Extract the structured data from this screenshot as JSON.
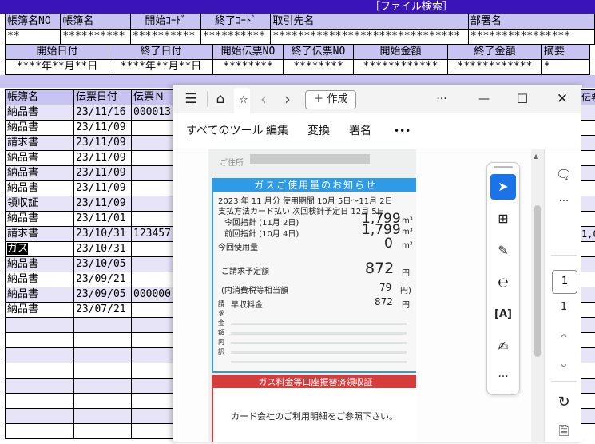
{
  "app": {
    "title": "［ファイル検索］"
  },
  "header1": {
    "labels": [
      "帳簿名NO",
      "帳簿名",
      "開始ｺｰﾄﾞ",
      "終了ｺｰﾄﾞ",
      "取引先名",
      "部署名"
    ],
    "values": [
      "**",
      "**********",
      "**********",
      "**********",
      "******************************",
      "****************"
    ]
  },
  "header2": {
    "labels": [
      "開始日付",
      "終了日付",
      "開始伝票NO",
      "終了伝票NO",
      "開始金額",
      "終了金額",
      "摘要"
    ],
    "values": [
      "****年**月**日",
      "****年**月**日",
      "********",
      "********",
      "************",
      "************",
      "*"
    ]
  },
  "list": {
    "columns": [
      "帳簿名",
      "伝票日付",
      "伝票Ｎ"
    ],
    "rows": [
      {
        "name": "納品書",
        "date": "23/11/16",
        "no": "000013"
      },
      {
        "name": "納品書",
        "date": "23/11/09",
        "no": ""
      },
      {
        "name": "請求書",
        "date": "23/11/09",
        "no": ""
      },
      {
        "name": "納品書",
        "date": "23/11/09",
        "no": ""
      },
      {
        "name": "納品書",
        "date": "23/11/09",
        "no": ""
      },
      {
        "name": "納品書",
        "date": "23/11/09",
        "no": ""
      },
      {
        "name": "領収証",
        "date": "23/11/09",
        "no": ""
      },
      {
        "name": "納品書",
        "date": "23/11/01",
        "no": ""
      },
      {
        "name": "請求書",
        "date": "23/10/31",
        "no": "123457"
      },
      {
        "name": "ガス",
        "date": "23/10/31",
        "no": ""
      },
      {
        "name": "納品書",
        "date": "23/10/05",
        "no": ""
      },
      {
        "name": "納品書",
        "date": "23/09/21",
        "no": ""
      },
      {
        "name": "納品書",
        "date": "23/09/05",
        "no": "000000"
      },
      {
        "name": "納品書",
        "date": "23/07/21",
        "no": ""
      }
    ],
    "right_edge": [
      "伝票",
      "",
      "",
      "",
      "",
      "",
      "",
      "",
      "",
      "1,0",
      "",
      "",
      "",
      ""
    ]
  },
  "viewer": {
    "toolbar": {
      "menu": "☰",
      "home": "⌂",
      "back": "‹",
      "forward": "›",
      "create": "＋ 作成",
      "more": "···",
      "minimize": "—",
      "maximize": "☐",
      "close": "✕"
    },
    "tabs": [
      "すべてのツール",
      "編集",
      "変換",
      "署名",
      "•••"
    ],
    "page_number": "1",
    "page_total": "1",
    "side_icons": [
      "comment-icon",
      "more-icon",
      "zoom-up-icon",
      "zoom-down-icon",
      "rotate-icon",
      "page-fit-icon"
    ]
  },
  "receipt": {
    "address_label": "ご住所",
    "title": "ガスご使用量のお知らせ",
    "line1": "2023 年 11 月分  使用期間  10月 5日〜11月 2日",
    "line2": "支払方法カード払い   次回検針予定日  12月 5日",
    "reading_now_label": "今回指針 (11月 2日)",
    "reading_now": "1,799",
    "reading_prev_label": "前回指針 (10月 4日)",
    "reading_prev": "1,799",
    "unit": "m³",
    "usage_label": "今回使用量",
    "usage": "0",
    "billing_label": "ご請求予定額",
    "billing": "872",
    "yen": "円",
    "tax_label": "(内消費税等相当額",
    "tax": "79",
    "tax_yen": "円)",
    "early_label": "早収料金",
    "early": "872",
    "side_label": "請求金額内訳",
    "red_title": "ガス料金等口座振替済領収証",
    "card_note": "カード会社のご利用明細をご参照下さい。"
  }
}
